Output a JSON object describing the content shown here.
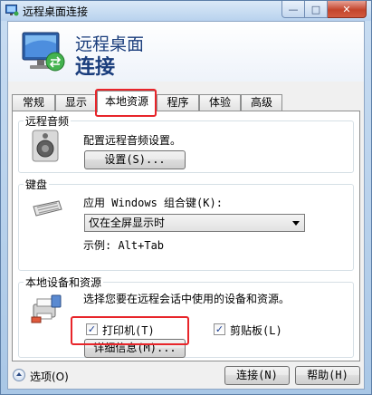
{
  "window": {
    "title": "远程桌面连接",
    "minimize_glyph": "—",
    "maximize_glyph": "□",
    "close_glyph": "✕"
  },
  "banner": {
    "line1": "远程桌面",
    "line2": "连接"
  },
  "tabs": [
    "常规",
    "显示",
    "本地资源",
    "程序",
    "体验",
    "高级"
  ],
  "active_tab": "本地资源",
  "remote_audio": {
    "group_title": "远程音频",
    "description": "配置远程音频设置。",
    "settings_button": "设置(S)..."
  },
  "keyboard": {
    "group_title": "键盘",
    "label": "应用 Windows 组合键(K):",
    "selected_option": "仅在全屏显示时",
    "example": "示例: Alt+Tab"
  },
  "local_devices": {
    "group_title": "本地设备和资源",
    "description": "选择您要在远程会话中使用的设备和资源。",
    "printers_label": "打印机(T)",
    "printers_checked": true,
    "clipboard_label": "剪贴板(L)",
    "clipboard_checked": true,
    "details_button": "详细信息(M)..."
  },
  "footer": {
    "options_label": "选项(O)",
    "connect_button": "连接(N)",
    "help_button": "帮助(H)"
  },
  "check_glyph": "✓"
}
